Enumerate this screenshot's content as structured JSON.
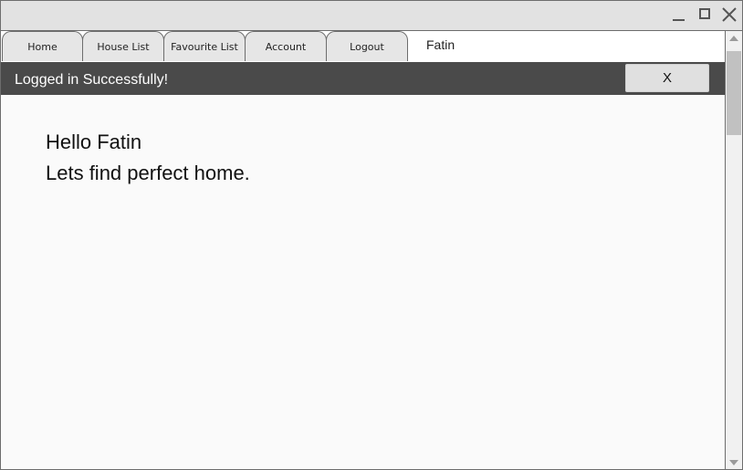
{
  "window": {
    "controls": {
      "minimize": "minimize-icon",
      "maximize": "maximize-icon",
      "close": "close-icon"
    }
  },
  "tabs": [
    {
      "label": "Home"
    },
    {
      "label": "House List"
    },
    {
      "label": "Favourite List"
    },
    {
      "label": "Account"
    },
    {
      "label": "Logout"
    }
  ],
  "user": {
    "name": "Fatin"
  },
  "alert": {
    "message": "Logged in Successfully!",
    "close_label": "X"
  },
  "main": {
    "greeting_line1": "Hello Fatin",
    "greeting_line2": "Lets find perfect home."
  },
  "colors": {
    "alert_bg": "#4a4a4a",
    "tab_bg": "#e6e6e6",
    "titlebar_bg": "#e2e2e2"
  }
}
